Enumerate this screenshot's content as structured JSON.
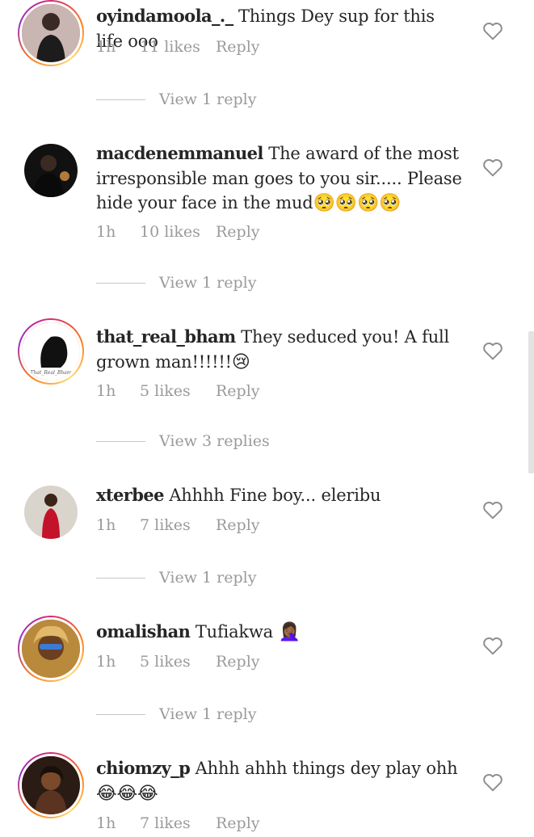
{
  "comments": [
    {
      "username": "oyindamoola_._",
      "text": "Things Dey sup for this life ooo",
      "emoji": "",
      "time": "1h",
      "likes": "11 likes",
      "reply": "Reply",
      "view_replies": "View 1 reply"
    },
    {
      "username": "macdenemmanuel",
      "text": "The award of the most irresponsible man goes to you sir..... Please hide your face in the mud",
      "emoji": "🥺🥺🥺🥺",
      "time": "1h",
      "likes": "10 likes",
      "reply": "Reply",
      "view_replies": "View 1 reply"
    },
    {
      "username": "that_real_bham",
      "text": "They seduced you! A full grown man!!!!!!",
      "emoji": "😢",
      "time": "1h",
      "likes": "5 likes",
      "reply": "Reply",
      "view_replies": "View 3 replies",
      "avatar_caption": "That_Real_Bham"
    },
    {
      "username": "xterbee",
      "text": "Ahhhh Fine boy... eleribu",
      "emoji": "",
      "time": "1h",
      "likes": "7 likes",
      "reply": "Reply",
      "view_replies": "View 1 reply"
    },
    {
      "username": "omalishan",
      "text": "Tufiakwa",
      "emoji": "🤦🏾‍♀️",
      "time": "1h",
      "likes": "5 likes",
      "reply": "Reply",
      "view_replies": "View 1 reply"
    },
    {
      "username": "chiomzy_p",
      "text": "Ahhh ahhh things dey play ohh",
      "emoji": "😂😂😂",
      "time": "1h",
      "likes": "7 likes",
      "reply": "Reply"
    }
  ],
  "icons": {
    "like": "heart-outline-icon"
  },
  "colors": {
    "muted": "#9a9a9a",
    "text": "#262626",
    "ring_start": "#d62976",
    "ring_end": "#fa7e1e"
  }
}
